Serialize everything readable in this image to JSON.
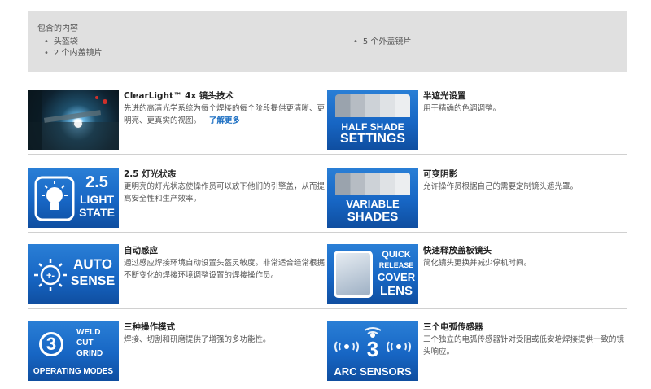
{
  "in_box": {
    "title": "包含的内容",
    "col1": [
      "头盔袋",
      "2 个内盖镜片"
    ],
    "col2": [
      "5 个外盖镜片"
    ]
  },
  "features": [
    {
      "name": "ClearLight™ 4x 镜头技术",
      "desc": "先进的高清光学系统为每个焊接的每个阶段提供更清晰、更明亮、更真实的视图。",
      "link": "了解更多",
      "tile": "photo"
    },
    {
      "name": "半遮光设置",
      "desc": "用于精确的色调调整。",
      "tile": "HALF SHADE SETTINGS"
    },
    {
      "name": "2.5 灯光状态",
      "desc": "更明亮的灯光状态使操作员可以放下他们的引擎盖，从而提高安全性和生产效率。",
      "tile": "2.5 LIGHT STATE"
    },
    {
      "name": "可变阴影",
      "desc": "允许操作员根据自己的需要定制镜头遮光罩。",
      "tile": "VARIABLE SHADES"
    },
    {
      "name": "自动感应",
      "desc": "通过感应焊接环境自动设置头盔灵敏度。非常适合经常根据不断变化的焊接环境调整设置的焊接操作员。",
      "tile": "AUTO SENSE"
    },
    {
      "name": "快速释放盖板镜头",
      "desc": "简化镜头更换并减少停机时间。",
      "tile": "QUICK RELEASE COVER LENS"
    },
    {
      "name": "三种操作模式",
      "desc": "焊接、切割和研磨提供了增强的多功能性。",
      "tile": "3 WELD CUT GRIND OPERATING MODES"
    },
    {
      "name": "三个电弧传感器",
      "desc": "三个独立的电弧传感器针对受阻或低安培焊接提供一致的镜头响应。",
      "tile": "3 ARC SENSORS"
    }
  ],
  "tiles": {
    "half": [
      "HALF SHADE",
      "SETTINGS"
    ],
    "light": [
      "2.5",
      "LIGHT",
      "STATE"
    ],
    "variable": [
      "VARIABLE",
      "SHADES"
    ],
    "auto": [
      "AUTO",
      "SENSE"
    ],
    "quick": [
      "QUICK",
      "RELEASE",
      "COVER",
      "LENS"
    ],
    "modes": [
      "3",
      "WELD",
      "CUT",
      "GRIND",
      "OPERATING MODES"
    ],
    "arc": [
      "3",
      "ARC SENSORS"
    ]
  },
  "colors": {
    "tile_blue": "#1766c4",
    "link": "#1b6ec2",
    "box_bg": "#e0e0e0"
  }
}
